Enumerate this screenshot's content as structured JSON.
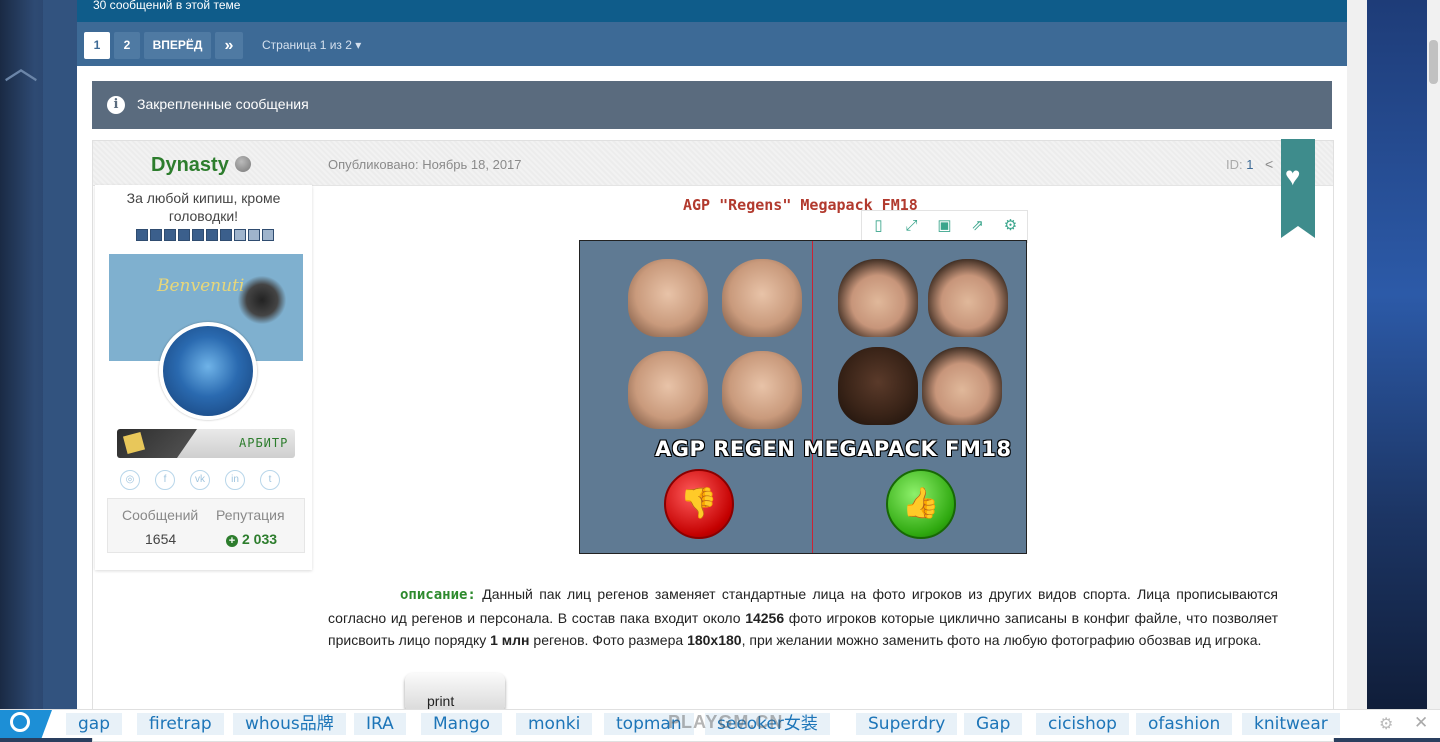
{
  "top_strip": {
    "text": "30 сообщений в этой теме"
  },
  "pagination": {
    "pages": [
      "1",
      "2"
    ],
    "next_label": "ВПЕРЁД",
    "last_label": "»",
    "page_info": "Страница 1 из 2 ▾"
  },
  "pinned": {
    "label": "Закрепленные сообщения",
    "icon": "info-icon"
  },
  "post": {
    "author": "Dynasty",
    "published": "Опубликовано: Ноябрь 18, 2017",
    "id_label": "ID:",
    "id_value": "1",
    "author_title": "За любой кипиш, кроме головодки!",
    "rank": {
      "filled": 7,
      "total": 10
    },
    "banner_text": "Benvenuti",
    "group_badge": "АРБИТР",
    "social_icons": [
      "instagram-icon",
      "facebook-icon",
      "vk-icon",
      "linkedin-icon",
      "twitter-icon"
    ],
    "stats": {
      "posts_label": "Сообщений",
      "posts_value": "1654",
      "rep_label": "Репутация",
      "rep_value": "2 033"
    },
    "title": "AGP \"Regens\" Megapack FM18",
    "image_title": "AGP REGEN MEGAPACK FM18",
    "image_toolbar": [
      "fit-icon",
      "expand-icon",
      "save-icon",
      "share-icon",
      "settings-icon"
    ],
    "description_label": "описание:",
    "description_parts": [
      " Данный пак лиц регенов заменяет стандартные лица на фото игроков из других видов спорта. Лица прописываются согласно ид регенов и персонала. В состав пака входит около ",
      "14256",
      " фото игроков которые циклично записаны в конфиг файле, что позволяет присвоить лицо порядку ",
      "1 млн",
      " регенов. Фото размера ",
      "180x180",
      ", при желании можно заменить фото на любую фотографию обозвав ид игрока."
    ],
    "key_label": "print"
  },
  "bottom_bar": {
    "tags": [
      "gap",
      "firetrap",
      "whous品牌",
      "IRA",
      "Mango",
      "monki",
      "topman",
      "seeoker女装",
      "Superdry",
      "Gap",
      "cicishop",
      "ofashion",
      "knitwear"
    ],
    "watermark": "PLAYGM.CN"
  },
  "colors": {
    "accent": "#3d6a96",
    "author": "#2d7d2d",
    "title": "#b23a2e",
    "ribbon": "#3e8c8c"
  }
}
